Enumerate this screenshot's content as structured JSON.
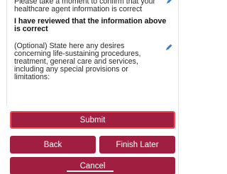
{
  "content": {
    "partial_line": "Please take a moment to confirm that your healthcare agent information is correct",
    "reviewed_statement": "I have reviewed that the information above is correct",
    "optional_statement": "(Optional) State here any desires concerning life-sustaining procedures, treatment, general care and services, including any special provisions or limitations:"
  },
  "icons": {
    "edit": "pencil-icon"
  },
  "colors": {
    "button_bg": "#a01e40",
    "focus_border": "#f04a55",
    "pencil": "#3a7bd5"
  },
  "buttons": {
    "submit": "Submit",
    "back": "Back",
    "finish_later": "Finish Later",
    "cancel": "Cancel"
  }
}
